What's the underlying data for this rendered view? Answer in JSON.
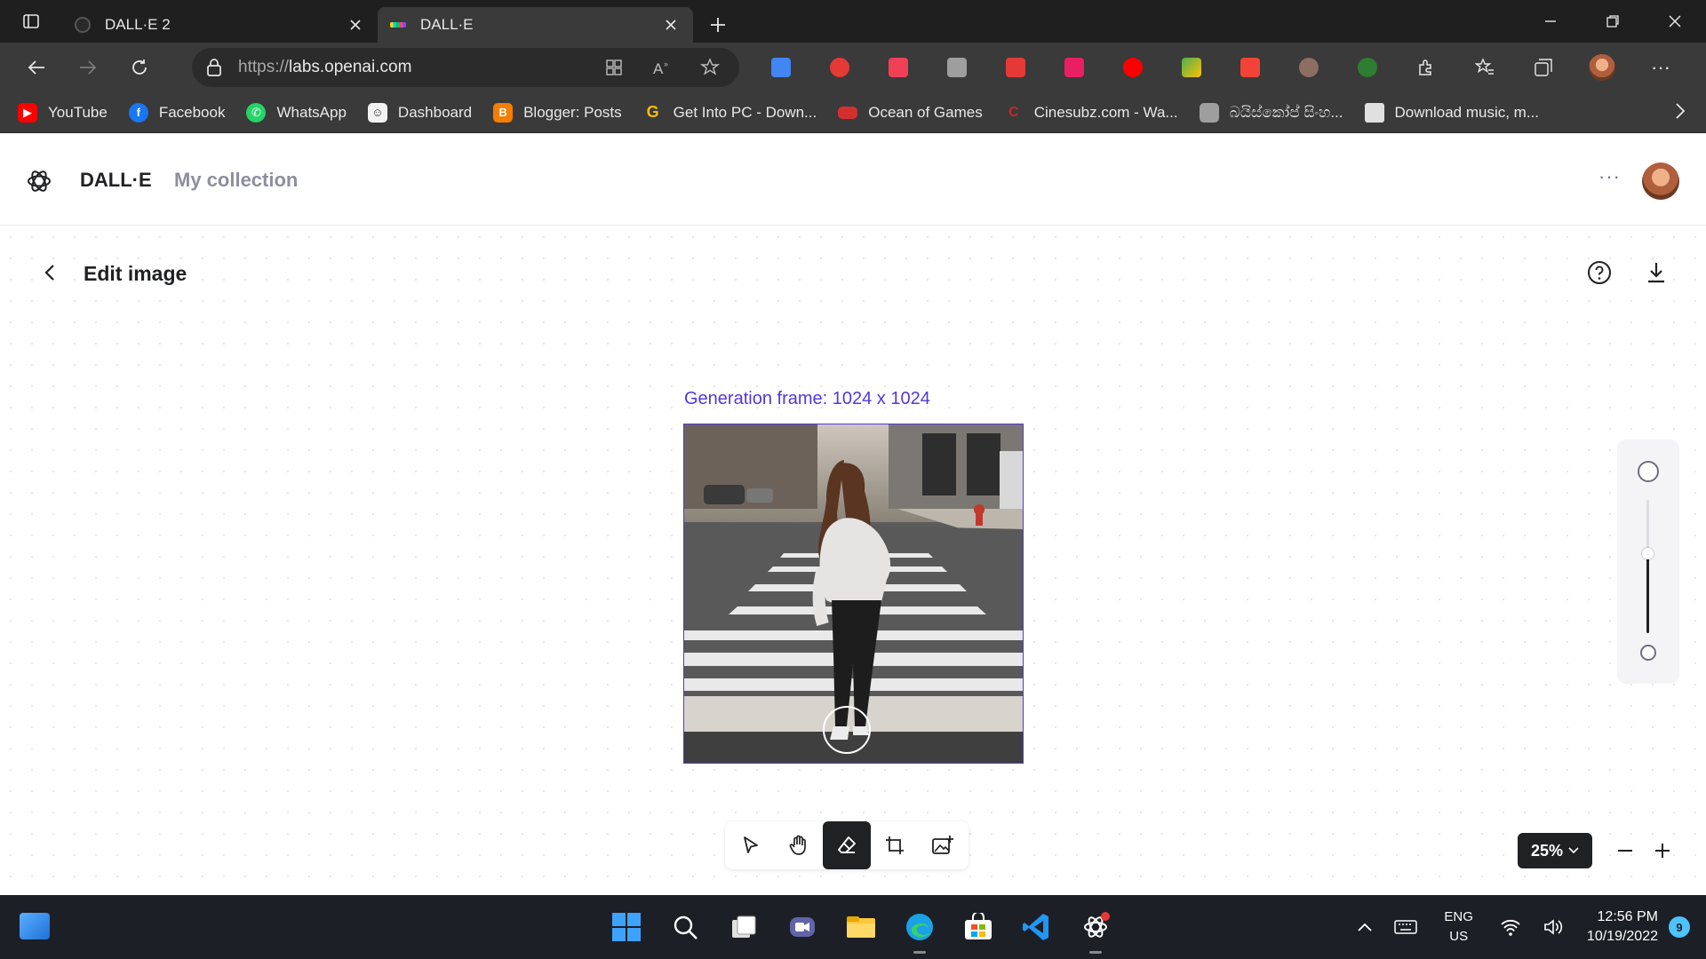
{
  "browser": {
    "tabs": [
      {
        "title": "DALL·E 2",
        "active": false,
        "icon": "openai-icon"
      },
      {
        "title": "DALL·E",
        "active": true,
        "icon": "dalle-icon"
      }
    ],
    "url_proto": "https://",
    "url_host": "labs.openai.com",
    "bookmarks": [
      {
        "label": "YouTube",
        "icon": "youtube-icon",
        "color": "#ff0000"
      },
      {
        "label": "Facebook",
        "icon": "facebook-icon",
        "color": "#1877f2"
      },
      {
        "label": "WhatsApp",
        "icon": "whatsapp-icon",
        "color": "#25d366"
      },
      {
        "label": "Dashboard",
        "icon": "dashboard-icon",
        "color": "#f2f2f2"
      },
      {
        "label": "Blogger: Posts",
        "icon": "blogger-icon",
        "color": "#f57d00"
      },
      {
        "label": "Get Into PC - Down...",
        "icon": "getintopc-icon",
        "color": "#34a853"
      },
      {
        "label": "Ocean of Games",
        "icon": "oceanofgames-icon",
        "color": "#d32f2f"
      },
      {
        "label": "Cinesubz.com - Wa...",
        "icon": "cinesubz-icon",
        "color": "#c62828"
      },
      {
        "label": "බයිස්කෝප් සිංහ...",
        "icon": "bioscope-icon",
        "color": "#9e9e9e"
      },
      {
        "label": "Download music, m...",
        "icon": "download-music-icon",
        "color": "#e0e0e0"
      }
    ]
  },
  "app": {
    "brand": "DALL·E",
    "collection_link": "My collection"
  },
  "editor": {
    "title": "Edit image",
    "generation_frame_label": "Generation frame: 1024 x 1024",
    "zoom_level": "25%",
    "zoom_slider_fraction": 0.6
  },
  "taskbar": {
    "lang_line1": "ENG",
    "lang_line2": "US",
    "time": "12:56 PM",
    "date": "10/19/2022",
    "notification_count": "9"
  },
  "colors": {
    "accent": "#5436da",
    "tool_active": "#202123"
  }
}
